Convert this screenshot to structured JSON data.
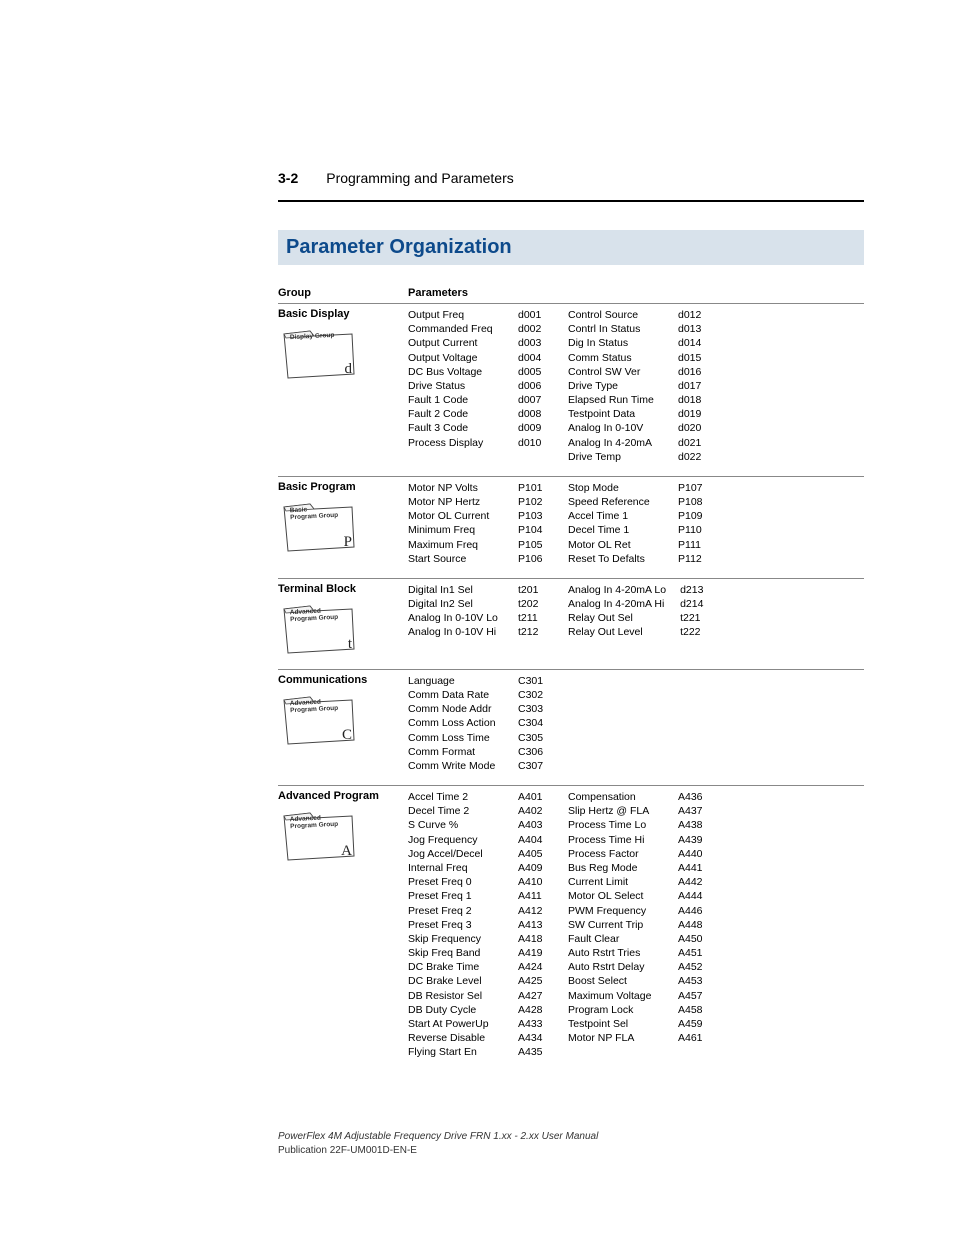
{
  "header": {
    "page_num": "3-2",
    "chapter": "Programming and Parameters"
  },
  "title": "Parameter Organization",
  "legend": {
    "group": "Group",
    "parameters": "Parameters"
  },
  "sections": [
    {
      "group_title": "Basic Display",
      "folder_label": "Display Group",
      "folder_letter": "d",
      "left": {
        "names": [
          "Output Freq",
          "Commanded Freq",
          "Output Current",
          "Output Voltage",
          "DC Bus Voltage",
          "Drive Status",
          "Fault 1 Code",
          "Fault 2 Code",
          "Fault 3 Code",
          "Process Display"
        ],
        "codes": [
          "d001",
          "d002",
          "d003",
          "d004",
          "d005",
          "d006",
          "d007",
          "d008",
          "d009",
          "d010"
        ]
      },
      "right": {
        "names": [
          "Control Source",
          "Contrl In Status",
          "Dig In Status",
          "Comm Status",
          "Control SW Ver",
          "Drive Type",
          "Elapsed Run Time",
          "Testpoint Data",
          "Analog In 0-10V",
          "Analog In 4-20mA",
          "Drive Temp"
        ],
        "codes": [
          "d012",
          "d013",
          "d014",
          "d015",
          "d016",
          "d017",
          "d018",
          "d019",
          "d020",
          "d021",
          "d022"
        ]
      }
    },
    {
      "group_title": "Basic Program",
      "folder_label": "Basic\nProgram Group",
      "folder_letter": "P",
      "left": {
        "names": [
          "Motor NP Volts",
          "Motor NP Hertz",
          "Motor OL Current",
          "Minimum Freq",
          "Maximum Freq",
          "Start Source"
        ],
        "codes": [
          "P101",
          "P102",
          "P103",
          "P104",
          "P105",
          "P106"
        ]
      },
      "right": {
        "names": [
          "Stop Mode",
          "Speed Reference",
          "Accel Time 1",
          "Decel Time 1",
          "Motor OL Ret",
          "Reset To Defalts"
        ],
        "codes": [
          "P107",
          "P108",
          "P109",
          "P110",
          "P111",
          "P112"
        ]
      }
    },
    {
      "group_title": "Terminal Block",
      "folder_label": "Advanced\nProgram Group",
      "folder_letter": "t",
      "left": {
        "names": [
          "Digital In1 Sel",
          "Digital In2 Sel",
          "Analog In 0-10V Lo",
          "Analog In 0-10V Hi"
        ],
        "codes": [
          "t201",
          "t202",
          "t211",
          "t212"
        ]
      },
      "right": {
        "names": [
          "Analog In 4-20mA Lo",
          "Analog In 4-20mA Hi",
          "Relay Out Sel",
          "Relay Out Level"
        ],
        "codes": [
          "d213",
          "d214",
          "t221",
          "t222"
        ]
      }
    },
    {
      "group_title": "Communications",
      "folder_label": "Advanced\nProgram Group",
      "folder_letter": "C",
      "left": {
        "names": [
          "Language",
          "Comm Data Rate",
          "Comm Node Addr",
          "Comm Loss Action",
          "Comm Loss Time",
          "Comm Format",
          "Comm Write Mode"
        ],
        "codes": [
          "C301",
          "C302",
          "C303",
          "C304",
          "C305",
          "C306",
          "C307"
        ]
      },
      "right": {
        "names": [],
        "codes": []
      }
    },
    {
      "group_title": "Advanced Program",
      "folder_label": "Advanced\nProgram Group",
      "folder_letter": "A",
      "left": {
        "names": [
          "Accel Time 2",
          "Decel Time 2",
          "S Curve %",
          "Jog Frequency",
          "Jog Accel/Decel",
          "Internal Freq",
          "Preset Freq 0",
          "Preset Freq 1",
          "Preset Freq 2",
          "Preset Freq 3",
          "Skip Frequency",
          "Skip Freq Band",
          "DC Brake Time",
          "DC Brake Level",
          "DB Resistor Sel",
          "DB Duty Cycle",
          "Start At PowerUp",
          "Reverse Disable",
          "Flying Start En"
        ],
        "codes": [
          "A401",
          "A402",
          "A403",
          "A404",
          "A405",
          "A409",
          "A410",
          "A411",
          "A412",
          "A413",
          "A418",
          "A419",
          "A424",
          "A425",
          "A427",
          "A428",
          "A433",
          "A434",
          "A435"
        ]
      },
      "right": {
        "names": [
          "Compensation",
          "Slip Hertz @ FLA",
          "Process Time Lo",
          "Process Time Hi",
          "Process Factor",
          "Bus Reg Mode",
          "Current Limit",
          "Motor OL Select",
          "PWM Frequency",
          "SW Current Trip",
          "Fault Clear",
          "Auto Rstrt Tries",
          "Auto Rstrt Delay",
          "Boost Select",
          "Maximum Voltage",
          "Program Lock",
          "Testpoint Sel",
          "Motor NP FLA"
        ],
        "codes": [
          "A436",
          "A437",
          "A438",
          "A439",
          "A440",
          "A441",
          "A442",
          "A444",
          "A446",
          "A448",
          "A450",
          "A451",
          "A452",
          "A453",
          "A457",
          "A458",
          "A459",
          "A461"
        ]
      }
    }
  ],
  "footer": {
    "line1": "PowerFlex 4M Adjustable Frequency Drive FRN 1.xx - 2.xx User Manual",
    "line2": "Publication 22F-UM001D-EN-E"
  }
}
